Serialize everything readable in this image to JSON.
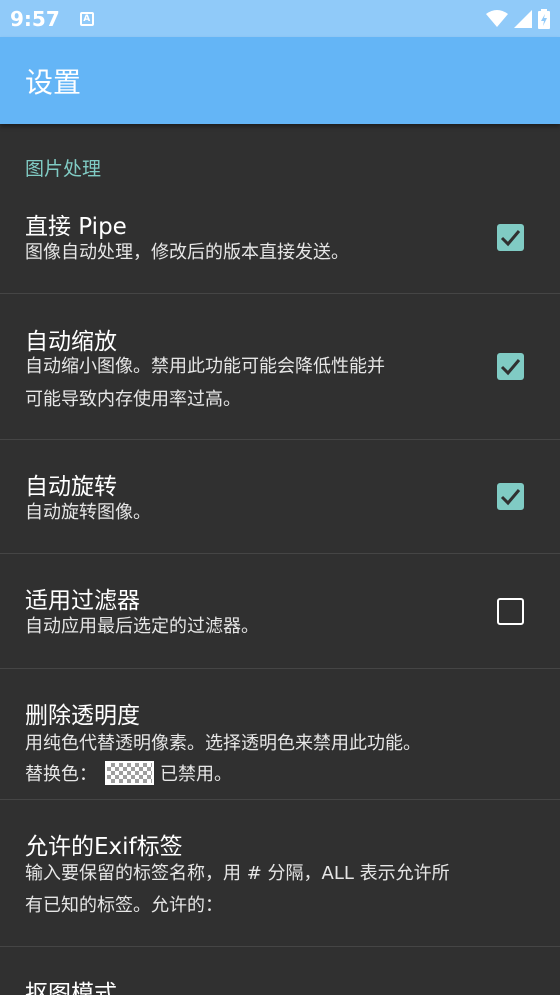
{
  "status_bar": {
    "time": "9:57",
    "notification_icon": "a-notification-icon",
    "icons": [
      "wifi-icon",
      "signal-icon",
      "battery-icon"
    ]
  },
  "app_bar": {
    "title": "设置"
  },
  "category": {
    "label": "图片处理"
  },
  "prefs": [
    {
      "title": "直接 Pipe",
      "summary": "图像自动处理，修改后的版本直接发送。",
      "checked": true
    },
    {
      "title": "自动缩放",
      "summary_line1": "自动缩小图像。禁用此功能可能会降低性能并",
      "summary_line2": "可能导致内存使用率过高。",
      "checked": true
    },
    {
      "title": "自动旋转",
      "summary": "自动旋转图像。",
      "checked": true
    },
    {
      "title": "适用过滤器",
      "summary": "自动应用最后选定的过滤器。",
      "checked": false
    },
    {
      "title": "删除透明度",
      "summary_line1": "用纯色代替透明像素。选择透明色来禁用此功能。",
      "replace_label": "替换色：",
      "replace_status": "已禁用。"
    },
    {
      "title": "允许的Exif标签",
      "summary_line1": "输入要保留的标签名称，用 # 分隔，ALL 表示允许所",
      "summary_line2": "有已知的标签。允许的："
    },
    {
      "title": "抠图模式"
    }
  ],
  "colors": {
    "accent": "#80cbc4",
    "app_bar": "#64b5f6",
    "status_bar": "#90caf9",
    "background": "#303030"
  }
}
